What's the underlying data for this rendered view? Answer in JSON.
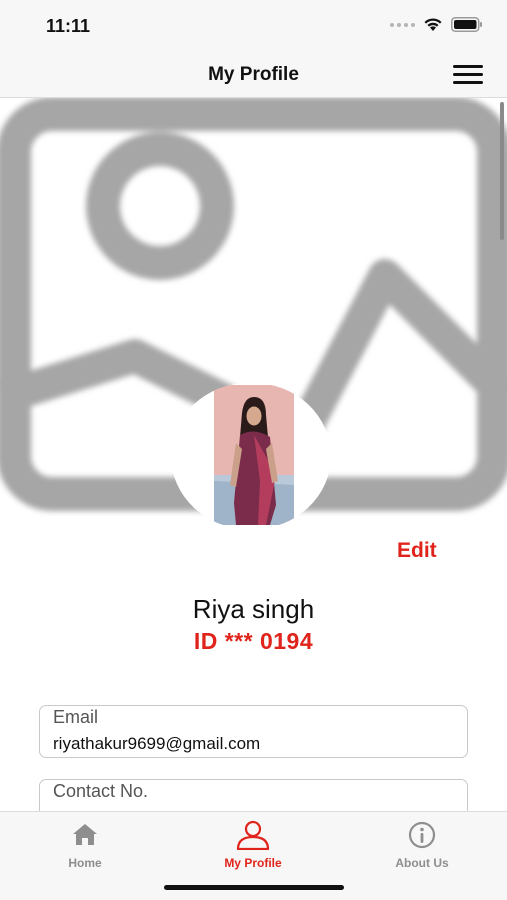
{
  "status_bar": {
    "time": "11:11"
  },
  "header": {
    "title": "My Profile"
  },
  "profile": {
    "edit_label": "Edit",
    "name": "Riya singh",
    "id_text": "ID *** 0194"
  },
  "form": {
    "email": {
      "label": "Email",
      "value": "riyathakur9699@gmail.com"
    },
    "contact": {
      "label": "Contact No.",
      "value": ""
    }
  },
  "tabs": [
    {
      "label": "Home",
      "icon": "home-icon",
      "active": false
    },
    {
      "label": "My Profile",
      "icon": "person-icon",
      "active": true
    },
    {
      "label": "About Us",
      "icon": "info-icon",
      "active": false
    }
  ],
  "colors": {
    "accent": "#e0241b",
    "inactive": "#8e8e8e"
  }
}
